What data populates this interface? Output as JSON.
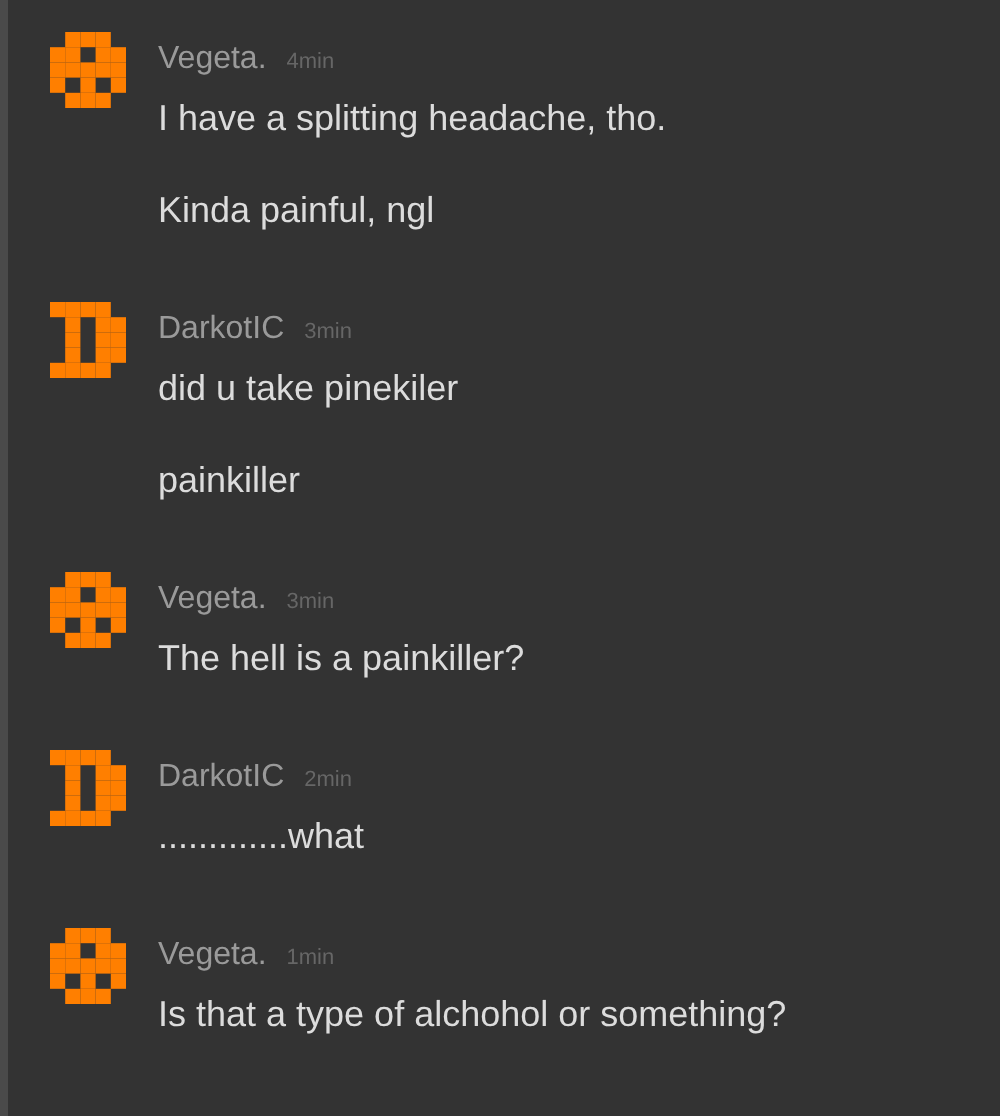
{
  "messages": [
    {
      "author": "Vegeta.",
      "time": "4min",
      "avatar": {
        "kind": "dots"
      },
      "lines": [
        "I have a splitting headache, tho.",
        "Kinda painful, ngl"
      ]
    },
    {
      "author": "DarkotIC",
      "time": "3min",
      "avatar": {
        "kind": "bar"
      },
      "lines": [
        "did u take pinekiler",
        "painkiller"
      ]
    },
    {
      "author": "Vegeta.",
      "time": "3min",
      "avatar": {
        "kind": "dots"
      },
      "lines": [
        "The hell is a painkiller?"
      ]
    },
    {
      "author": "DarkotIC",
      "time": "2min",
      "avatar": {
        "kind": "bar"
      },
      "lines": [
        ".............what"
      ]
    },
    {
      "author": "Vegeta.",
      "time": "1min",
      "avatar": {
        "kind": "dots"
      },
      "lines": [
        "Is that a type of alchohol or something?"
      ]
    }
  ]
}
